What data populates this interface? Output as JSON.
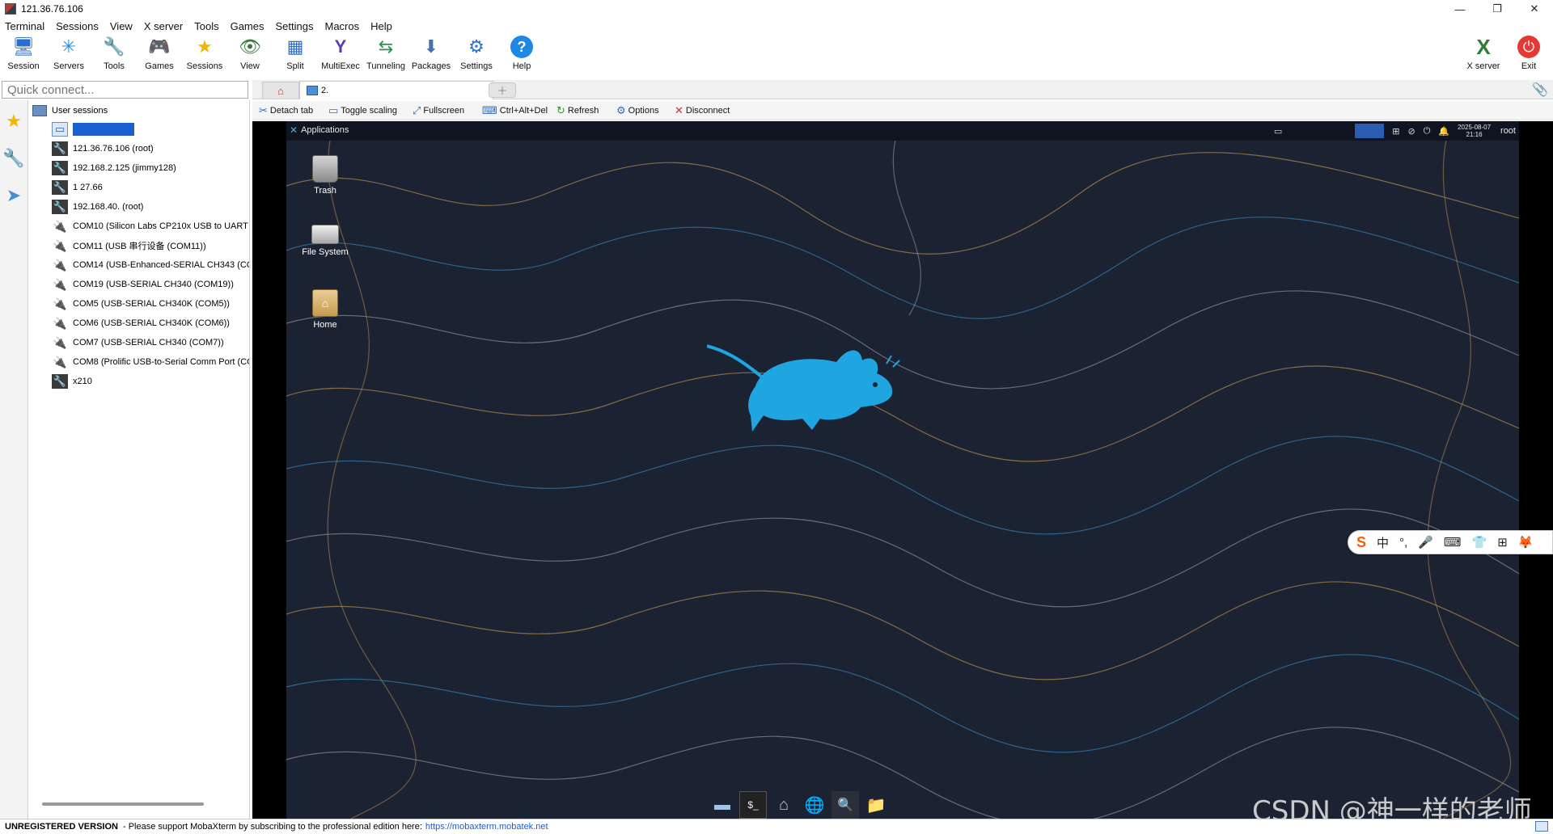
{
  "window": {
    "title": "121.36.76.106",
    "controls": [
      "—",
      "❐",
      "✕"
    ]
  },
  "menu": [
    "Terminal",
    "Sessions",
    "View",
    "X server",
    "Tools",
    "Games",
    "Settings",
    "Macros",
    "Help"
  ],
  "toolbar": {
    "left": [
      {
        "label": "Session",
        "icon": "session-icon",
        "glyph": "🖥"
      },
      {
        "label": "Servers",
        "icon": "servers-icon",
        "glyph": "✳"
      },
      {
        "label": "Tools",
        "icon": "tools-icon",
        "glyph": "🔧"
      },
      {
        "label": "Games",
        "icon": "games-icon",
        "glyph": "🎮"
      },
      {
        "label": "Sessions",
        "icon": "sessions-star-icon",
        "glyph": "★"
      },
      {
        "label": "View",
        "icon": "view-icon",
        "glyph": "👁"
      },
      {
        "label": "Split",
        "icon": "split-icon",
        "glyph": "▦"
      },
      {
        "label": "MultiExec",
        "icon": "multiexec-icon",
        "glyph": "Y"
      },
      {
        "label": "Tunneling",
        "icon": "tunneling-icon",
        "glyph": "⇆"
      },
      {
        "label": "Packages",
        "icon": "packages-icon",
        "glyph": "⬇"
      },
      {
        "label": "Settings",
        "icon": "settings-icon",
        "glyph": "⚙"
      },
      {
        "label": "Help",
        "icon": "help-icon",
        "glyph": "?"
      }
    ],
    "right": [
      {
        "label": "X server",
        "icon": "xserver-icon",
        "glyph": "X"
      },
      {
        "label": "Exit",
        "icon": "exit-icon",
        "glyph": "⏻"
      }
    ]
  },
  "quick_connect": {
    "placeholder": "Quick connect..."
  },
  "tabs": {
    "active_label": "2. "
  },
  "sessions": {
    "root_label": "User sessions",
    "items": [
      {
        "label": "",
        "type": "xdmcp",
        "selected": true
      },
      {
        "label": "121.36.76.106 (root)",
        "type": "ssh"
      },
      {
        "label": "192.168.2.125 (jimmy128)",
        "type": "ssh"
      },
      {
        "label": "1            27.66",
        "type": "ssh"
      },
      {
        "label": "192.168.40.      (root)",
        "type": "ssh"
      },
      {
        "label": "COM10  (Silicon Labs CP210x USB to UART B",
        "type": "serial"
      },
      {
        "label": "COM11  (USB 串行设备 (COM11))",
        "type": "serial"
      },
      {
        "label": "COM14  (USB-Enhanced-SERIAL CH343 (COI",
        "type": "serial"
      },
      {
        "label": "COM19  (USB-SERIAL CH340 (COM19))",
        "type": "serial"
      },
      {
        "label": "COM5  (USB-SERIAL CH340K (COM5))",
        "type": "serial"
      },
      {
        "label": "COM6  (USB-SERIAL CH340K (COM6))",
        "type": "serial"
      },
      {
        "label": "COM7  (USB-SERIAL CH340 (COM7))",
        "type": "serial"
      },
      {
        "label": "COM8  (Prolific USB-to-Serial Comm Port (CO",
        "type": "serial"
      },
      {
        "label": "x210",
        "type": "ssh"
      }
    ]
  },
  "remote_toolbar": [
    {
      "label": "Detach tab",
      "icon": "detach-icon",
      "glyph": "✂"
    },
    {
      "label": "Toggle scaling",
      "icon": "scaling-icon",
      "glyph": "▭"
    },
    {
      "label": "Fullscreen",
      "icon": "fullscreen-icon",
      "glyph": "⤢"
    },
    {
      "label": "Ctrl+Alt+Del",
      "icon": "ctrlaltdel-icon",
      "glyph": "⌨"
    },
    {
      "label": "Refresh",
      "icon": "refresh-icon",
      "glyph": "↻"
    },
    {
      "label": "Options",
      "icon": "options-icon",
      "glyph": "⚙"
    },
    {
      "label": "Disconnect",
      "icon": "disconnect-icon",
      "glyph": "✕"
    }
  ],
  "xfce": {
    "applications_label": "Applications",
    "clock_date": "2025-08-07",
    "clock_time": "21:16",
    "user": "root",
    "desktop_icons": [
      "Trash",
      "File System",
      "Home"
    ],
    "dock": [
      "show-desktop-icon",
      "terminal-icon",
      "file-manager-icon",
      "web-browser-icon",
      "search-icon",
      "folder-icon"
    ]
  },
  "ime_bar": [
    "S",
    "中",
    "°,",
    "🎤",
    "⌨",
    "👕",
    "⊞",
    "🦊"
  ],
  "watermark": "CSDN @神一样的老师",
  "status": {
    "unregistered": "UNREGISTERED VERSION",
    "message": " -  Please support MobaXterm by subscribing to the professional edition here:",
    "link": "https://mobaxterm.mobatek.net"
  }
}
